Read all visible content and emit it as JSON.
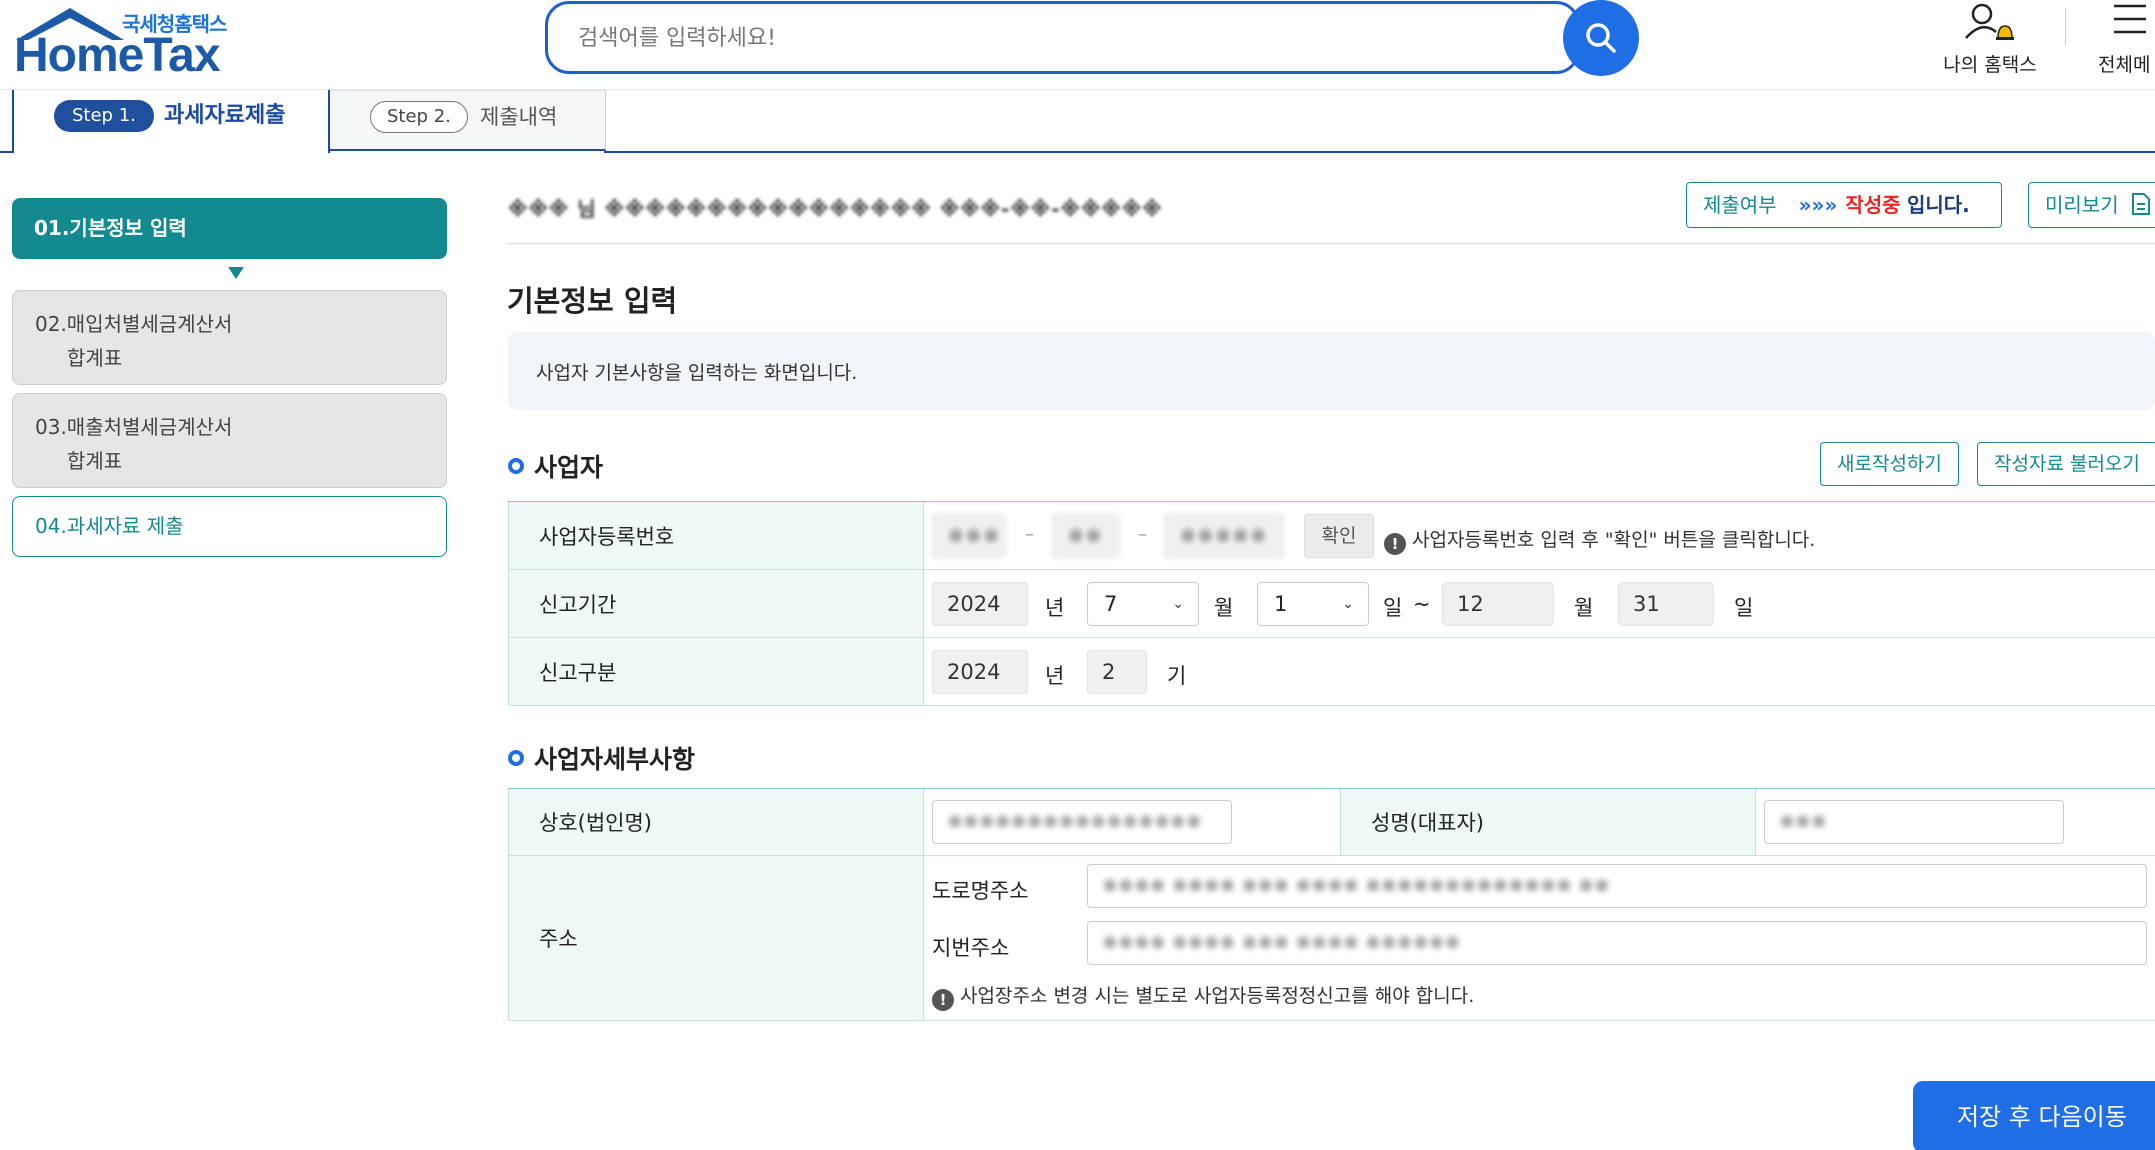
{
  "header": {
    "logo_sub": "국세청홈택스",
    "logo_main": "HomeTax",
    "search_placeholder": "검색어를 입력하세요!",
    "my_hometax": "나의 홈택스",
    "all_menu": "전체메"
  },
  "tabs": [
    {
      "step": "Step 1.",
      "label": "과세자료제출",
      "active": true
    },
    {
      "step": "Step 2.",
      "label": "제출내역",
      "active": false
    }
  ],
  "sidebar": {
    "items": [
      {
        "line1": "01.기본정보 입력",
        "line2": "",
        "state": "active"
      },
      {
        "line1": "02.매입처별세금계산서",
        "line2": "합계표",
        "state": "inactive"
      },
      {
        "line1": "03.매출처별세금계산서",
        "line2": "합계표",
        "state": "inactive"
      },
      {
        "line1": "04.과세자료 제출",
        "line2": "",
        "state": "outline"
      }
    ]
  },
  "user_info": "※※※ 님  ※※※※※※※※※※※※※※※※  ※※※-※※-※※※※※",
  "status": {
    "label": "제출여부",
    "arrows": "»»»",
    "value": "작성중",
    "suffix": "입니다."
  },
  "preview_button": "미리보기",
  "page_title": "기본정보 입력",
  "description": "사업자 기본사항을 입력하는 화면입니다.",
  "section1": {
    "title": "사업자",
    "new_button": "새로작성하기",
    "load_button": "작성자료 불러오기",
    "brn": {
      "label": "사업자등록번호",
      "part1": "※※※",
      "part2": "※※",
      "part3": "※※※※※",
      "confirm": "확인",
      "hint": "사업자등록번호 입력 후 \"확인\" 버튼을 클릭합니다."
    },
    "period": {
      "label": "신고기간",
      "year": "2024",
      "year_unit": "년",
      "start_month": "7",
      "month_unit": "월",
      "start_day": "1",
      "day_unit": "일",
      "tilde": "~",
      "end_month": "12",
      "end_month_unit": "월",
      "end_day": "31",
      "end_day_unit": "일"
    },
    "type": {
      "label": "신고구분",
      "year": "2024",
      "year_unit": "년",
      "term": "2",
      "term_unit": "기"
    }
  },
  "section2": {
    "title": "사업자세부사항",
    "company": {
      "label": "상호(법인명)",
      "value": "※※※※※※※※※※※※※※※※"
    },
    "representative": {
      "label": "성명(대표자)",
      "value": "※※※"
    },
    "address": {
      "label": "주소",
      "road_label": "도로명주소",
      "road_value": "※※※※ ※※※※ ※※※ ※※※※ ※※※※※※※※※※※※※ ※※",
      "lot_label": "지번주소",
      "lot_value": "※※※※ ※※※※ ※※※ ※※※※ ※※※※※※",
      "notice": "사업장주소 변경 시는 별도로 사업자등록정정신고를 해야 합니다."
    }
  },
  "save_button": "저장 후 다음이동",
  "colors": {
    "primary_blue": "#1f6ee6",
    "teal": "#138a8f",
    "navy": "#1c4aa0",
    "status_red": "#e22222"
  }
}
